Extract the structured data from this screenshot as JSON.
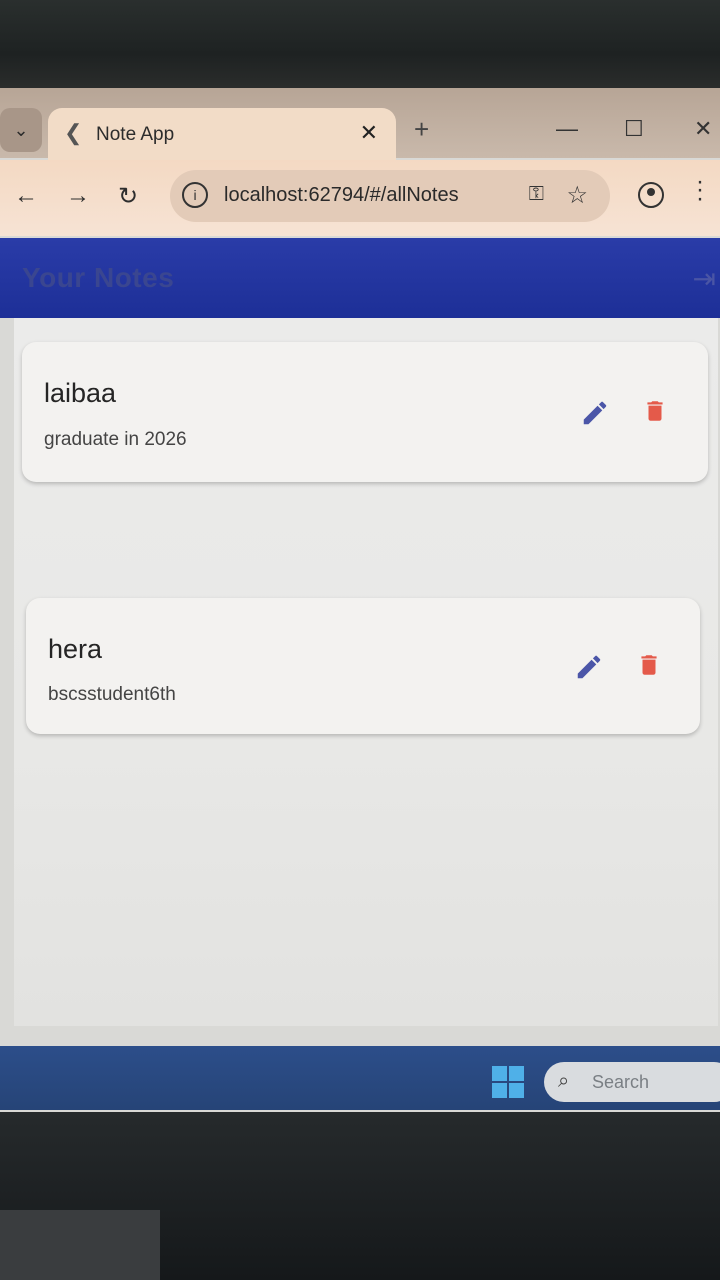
{
  "browser": {
    "tab_title": "Note App",
    "url": "localhost:62794/#/allNotes",
    "tab_close_glyph": "✕",
    "new_tab_glyph": "+"
  },
  "app": {
    "title": "Your Notes",
    "fab_glyph": "+"
  },
  "notes": [
    {
      "title": "laibaa",
      "content": "graduate in 2026"
    },
    {
      "title": "hera",
      "content": "bscsstudent6th"
    }
  ],
  "taskbar": {
    "search_label": "Search"
  },
  "colors": {
    "appbar": "#1d2f97",
    "edit": "#4b56a8",
    "delete": "#e45a4a",
    "fab": "#3a8fe3"
  },
  "icons": {
    "edit": "pencil-icon",
    "delete": "trash-icon",
    "logout": "logout-icon"
  }
}
